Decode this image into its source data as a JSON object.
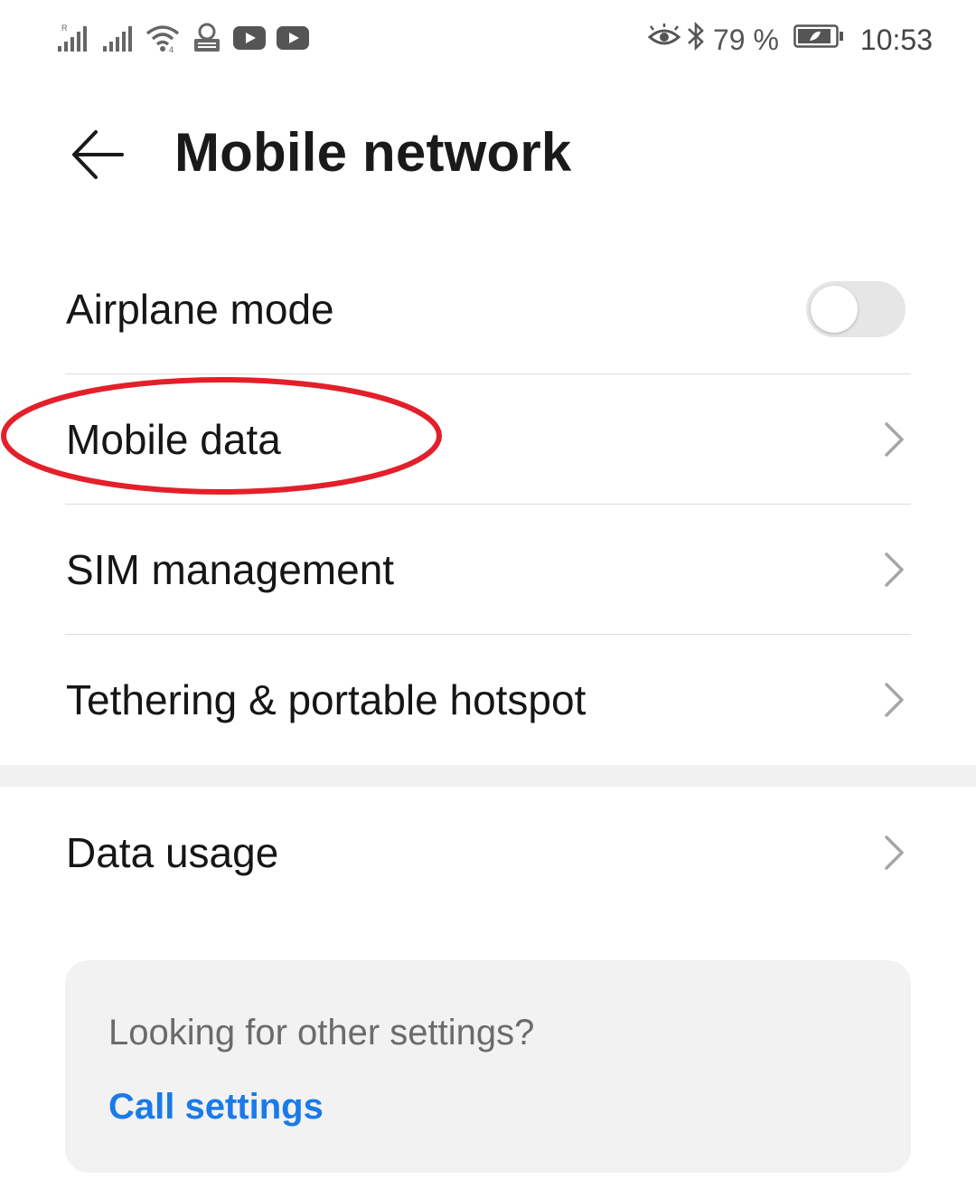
{
  "status_bar": {
    "battery_percent": "79 %",
    "time": "10:53",
    "icons_left": [
      "signal-icon",
      "signal-icon",
      "wifi-icon",
      "vpn-icon",
      "youtube-icon",
      "youtube-icon"
    ],
    "icons_right": [
      "eye-icon",
      "bluetooth-icon",
      "battery-icon"
    ]
  },
  "header": {
    "title": "Mobile network"
  },
  "list": {
    "airplane_mode": {
      "label": "Airplane mode",
      "enabled": false
    },
    "mobile_data": {
      "label": "Mobile data"
    },
    "sim_management": {
      "label": "SIM management"
    },
    "tethering": {
      "label": "Tethering & portable hotspot"
    },
    "data_usage": {
      "label": "Data usage"
    }
  },
  "card": {
    "question": "Looking for other settings?",
    "link": "Call settings"
  },
  "colors": {
    "accent": "#1a7ae8",
    "highlight": "#e3202a"
  }
}
